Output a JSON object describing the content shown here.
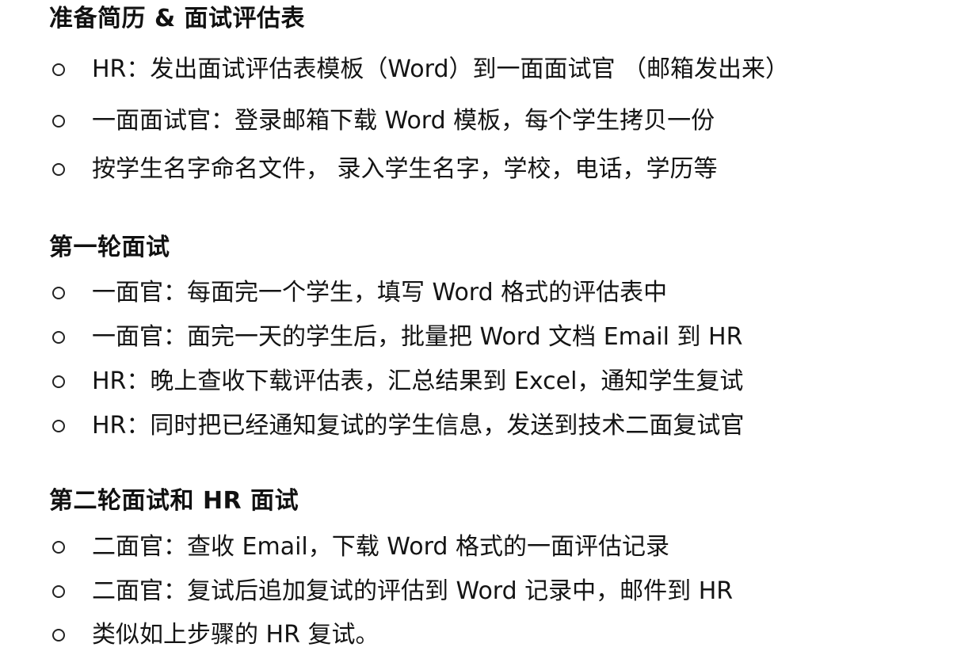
{
  "sections": [
    {
      "title": "准备简历 & 面试评估表",
      "items": [
        "HR：发出面试评估表模板（Word）到一面面试官 （邮箱发出来）",
        "一面面试官：登录邮箱下载 Word 模板，每个学生拷贝一份",
        "按学生名字命名文件， 录入学生名字，学校，电话，学历等"
      ]
    },
    {
      "title": "第一轮面试",
      "items": [
        "一面官：每面完一个学生，填写 Word 格式的评估表中",
        "一面官：面完一天的学生后，批量把 Word 文档 Email 到 HR",
        "HR：晚上查收下载评估表，汇总结果到 Excel，通知学生复试",
        "HR：同时把已经通知复试的学生信息，发送到技术二面复试官"
      ]
    },
    {
      "title": "第二轮面试和 HR 面试",
      "items": [
        "二面官：查收 Email，下载 Word 格式的一面评估记录",
        "二面官：复试后追加复试的评估到 Word 记录中，邮件到 HR",
        "类似如上步骤的 HR 复试。"
      ]
    }
  ]
}
